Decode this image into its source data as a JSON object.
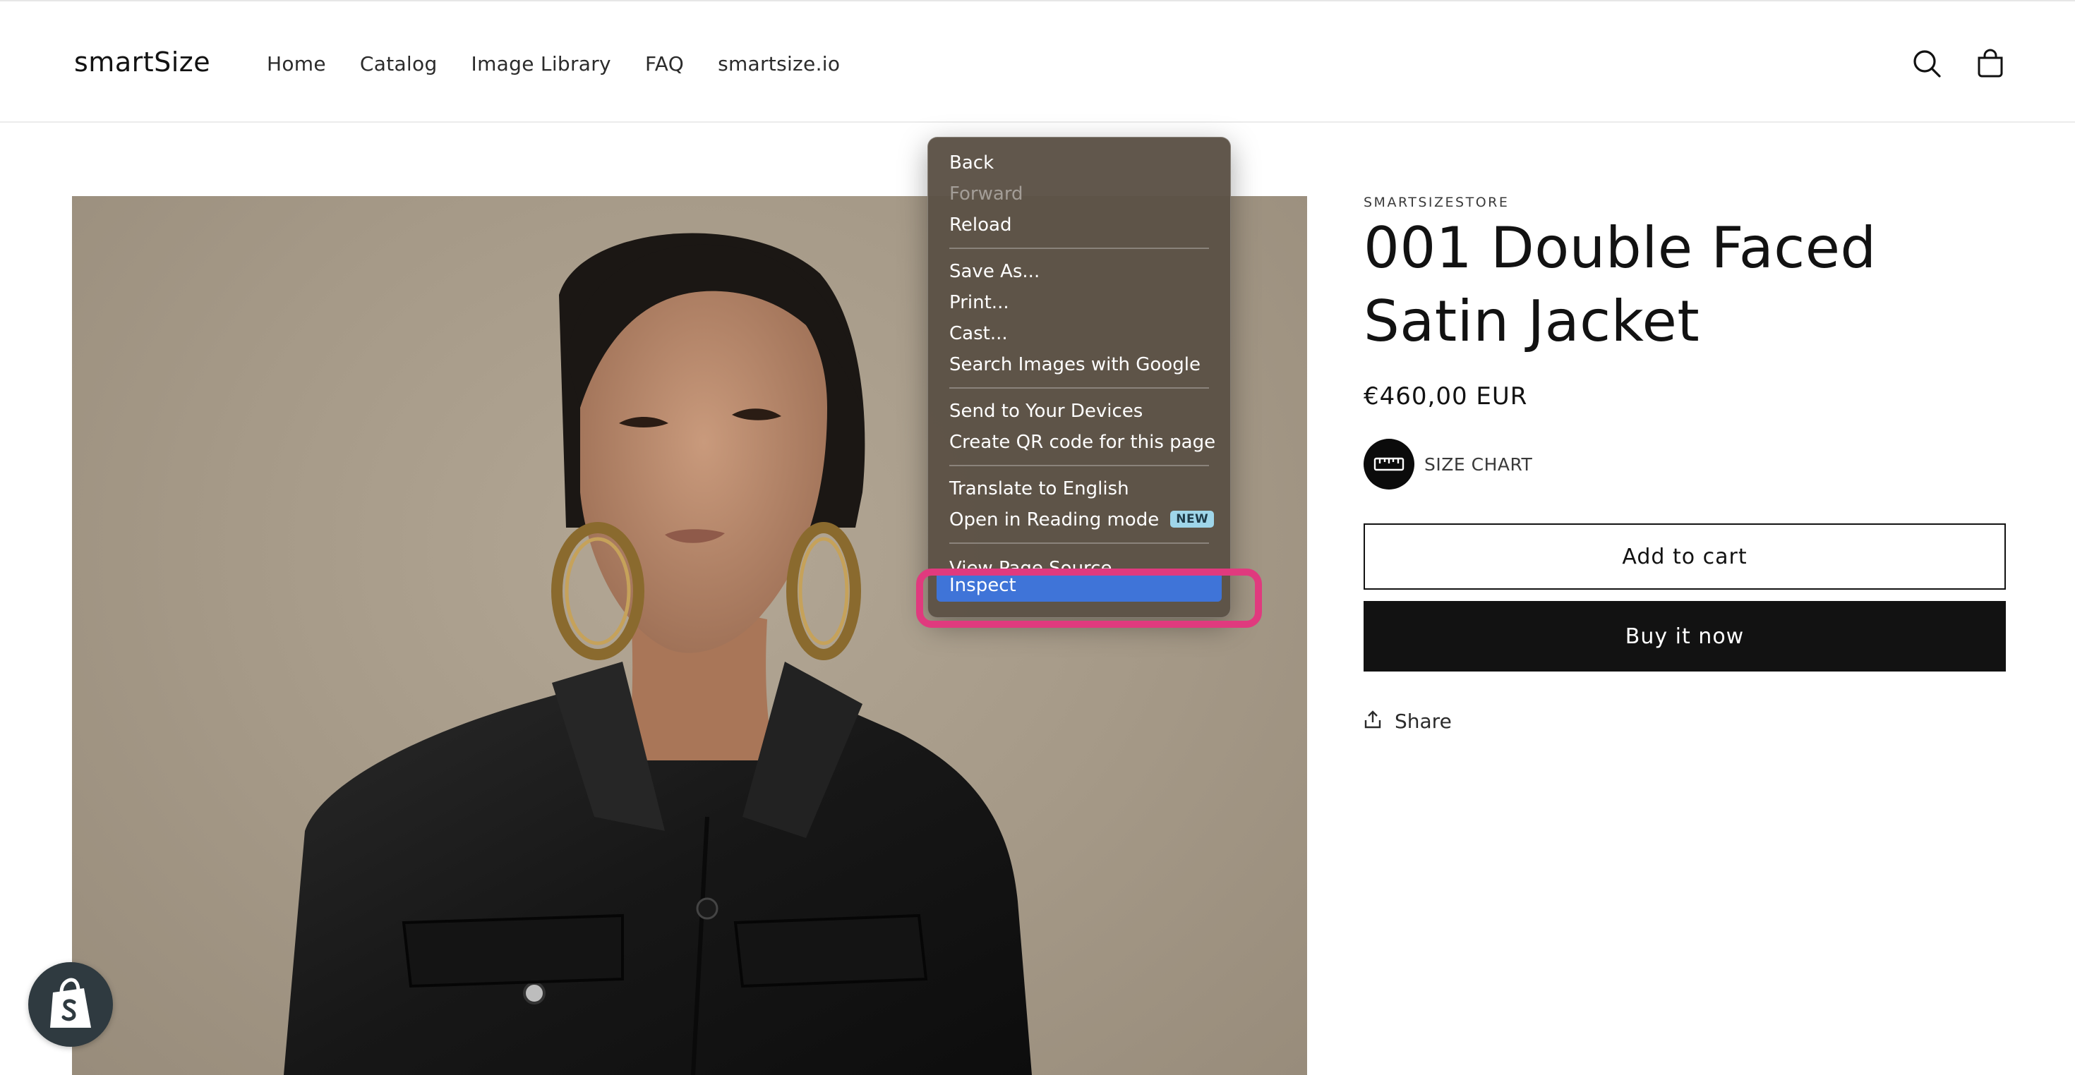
{
  "header": {
    "logo": "smartSize",
    "nav": [
      "Home",
      "Catalog",
      "Image Library",
      "FAQ",
      "smartsize.io"
    ],
    "icons": [
      "search-icon",
      "cart-icon"
    ]
  },
  "product": {
    "vendor": "SMARTSIZESTORE",
    "title": "001 Double Faced Satin Jacket",
    "price": "€460,00 EUR",
    "size_chart_label": "SIZE CHART",
    "add_to_cart_label": "Add to cart",
    "buy_now_label": "Buy it now",
    "share_label": "Share"
  },
  "context_menu": {
    "groups": [
      [
        "Back",
        "Forward",
        "Reload"
      ],
      [
        "Save As...",
        "Print...",
        "Cast...",
        "Search Images with Google"
      ],
      [
        "Send to Your Devices",
        "Create QR code for this page"
      ],
      [
        "Translate to English",
        "Open in Reading mode"
      ],
      [
        "View Page Source",
        "Inspect"
      ]
    ],
    "disabled": [
      "Forward"
    ],
    "new_badge": "NEW",
    "highlighted": "Inspect",
    "highlight_color": "#3f74d8",
    "annotation_ring_color": "#e03a7e"
  },
  "colors": {
    "text": "#121212",
    "button_dark": "#121212",
    "menu_bg": "#5c5246",
    "shopify_badge": "#2f3a40"
  }
}
